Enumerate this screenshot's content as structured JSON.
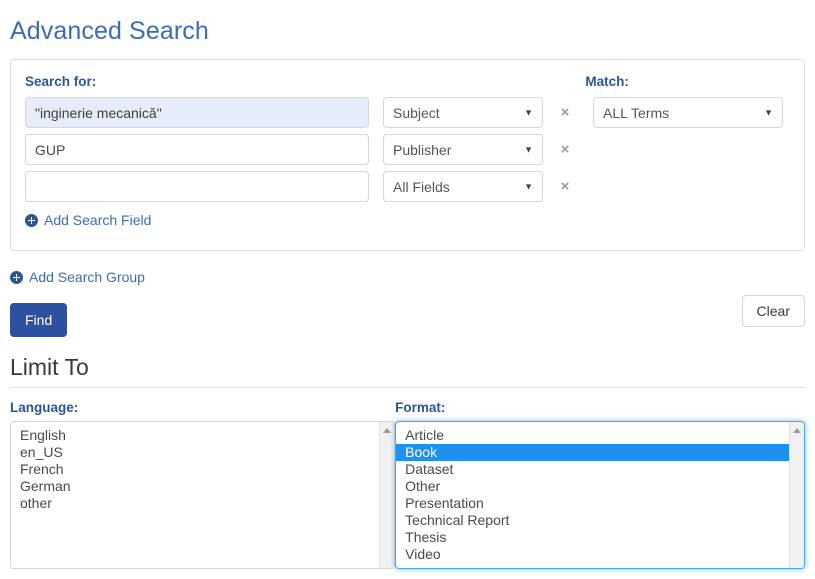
{
  "page": {
    "title": "Advanced Search"
  },
  "search_panel": {
    "search_for_label": "Search for:",
    "match_label": "Match:",
    "rows": [
      {
        "term_value": "\"inginerie mecanică\"",
        "term_placeholder": "",
        "field": "Subject",
        "remove_icon": "×"
      },
      {
        "term_value": "GUP",
        "term_placeholder": "",
        "field": "Publisher",
        "remove_icon": "×"
      },
      {
        "term_value": "",
        "term_placeholder": "",
        "field": "All Fields",
        "remove_icon": "×"
      }
    ],
    "match_value": "ALL Terms",
    "caret_icon": "▼",
    "add_search_field_label": "Add Search Field"
  },
  "add_search_group_label": "Add Search Group",
  "buttons": {
    "find_label": "Find",
    "clear_label": "Clear"
  },
  "limit_to": {
    "heading": "Limit To",
    "language": {
      "label": "Language:",
      "options": [
        "English",
        "en_US",
        "French",
        "German",
        "other"
      ],
      "selected": []
    },
    "format": {
      "label": "Format:",
      "options": [
        "Article",
        "Book",
        "Dataset",
        "Other",
        "Presentation",
        "Technical Report",
        "Thesis",
        "Video"
      ],
      "selected": [
        "Book"
      ]
    }
  },
  "colors": {
    "title_blue": "#3c6cb4",
    "label_blue": "#2b5797",
    "find_button_blue": "#2d51a0",
    "selection_blue": "#1e90f0",
    "autofill_background": "#e6ecf9",
    "focus_border_blue": "#4da3f0"
  }
}
